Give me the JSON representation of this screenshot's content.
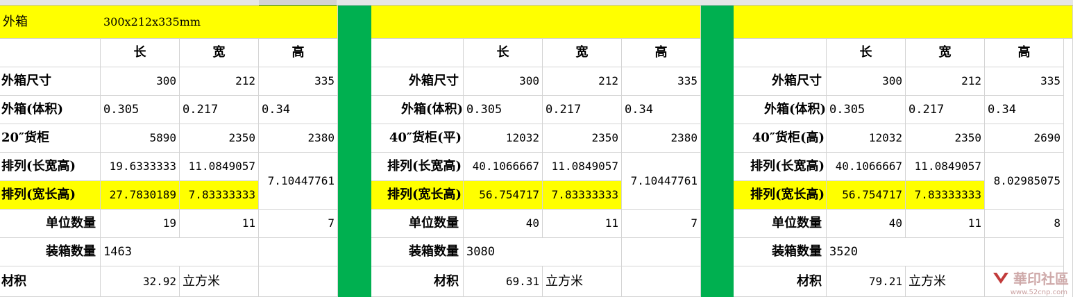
{
  "header": {
    "label": "外箱",
    "spec": "300x212x335mm"
  },
  "dims_header": [
    "长",
    "宽",
    "高"
  ],
  "blocks": [
    {
      "rows": {
        "outer_size": {
          "label": "外箱尺寸",
          "values": [
            "300",
            "212",
            "335"
          ]
        },
        "outer_volume": {
          "label": "外箱(体积)",
          "values": [
            "0.305",
            "0.217",
            "0.34"
          ]
        },
        "container": {
          "label": "20″货柜",
          "values": [
            "5890",
            "2350",
            "2380"
          ]
        },
        "arrange_lwh": {
          "label": "排列(长宽高)",
          "values": [
            "19.6333333",
            "11.0849057"
          ]
        },
        "arrange_wlh": {
          "label": "排列(宽长高)",
          "values": [
            "27.7830189",
            "7.83333333"
          ]
        },
        "arrange_height": "7.10447761",
        "unit_qty": {
          "label": "单位数量",
          "values": [
            "19",
            "11",
            "7"
          ]
        },
        "pack_qty": {
          "label": "装箱数量",
          "value": "1463"
        },
        "volume": {
          "label": "材积",
          "value": "32.92",
          "unit": "立方米"
        }
      }
    },
    {
      "rows": {
        "outer_size": {
          "label": "外箱尺寸",
          "values": [
            "300",
            "212",
            "335"
          ]
        },
        "outer_volume": {
          "label": "外箱(体积)",
          "values": [
            "0.305",
            "0.217",
            "0.34"
          ]
        },
        "container": {
          "label": "40″货柜(平)",
          "values": [
            "12032",
            "2350",
            "2380"
          ]
        },
        "arrange_lwh": {
          "label": "排列(长宽高)",
          "values": [
            "40.1066667",
            "11.0849057"
          ]
        },
        "arrange_wlh": {
          "label": "排列(宽长高)",
          "values": [
            "56.754717",
            "7.83333333"
          ]
        },
        "arrange_height": "7.10447761",
        "unit_qty": {
          "label": "单位数量",
          "values": [
            "40",
            "11",
            "7"
          ]
        },
        "pack_qty": {
          "label": "装箱数量",
          "value": "3080"
        },
        "volume": {
          "label": "材积",
          "value": "69.31",
          "unit": "立方米"
        }
      }
    },
    {
      "rows": {
        "outer_size": {
          "label": "外箱尺寸",
          "values": [
            "300",
            "212",
            "335"
          ]
        },
        "outer_volume": {
          "label": "外箱(体积)",
          "values": [
            "0.305",
            "0.217",
            "0.34"
          ]
        },
        "container": {
          "label": "40″货柜(高)",
          "values": [
            "12032",
            "2350",
            "2690"
          ]
        },
        "arrange_lwh": {
          "label": "排列(长宽高)",
          "values": [
            "40.1066667",
            "11.0849057"
          ]
        },
        "arrange_wlh": {
          "label": "排列(宽长高)",
          "values": [
            "56.754717",
            "7.83333333"
          ]
        },
        "arrange_height": "8.02985075",
        "unit_qty": {
          "label": "单位数量",
          "values": [
            "40",
            "11",
            "8"
          ]
        },
        "pack_qty": {
          "label": "装箱数量",
          "value": "3520"
        },
        "volume": {
          "label": "材积",
          "value": "79.21",
          "unit": "立方米"
        }
      }
    }
  ],
  "watermark": {
    "text": "華印社區",
    "url": "www.52cnp.com"
  },
  "colors": {
    "highlight": "#ffff00",
    "divider": "#00b050"
  }
}
